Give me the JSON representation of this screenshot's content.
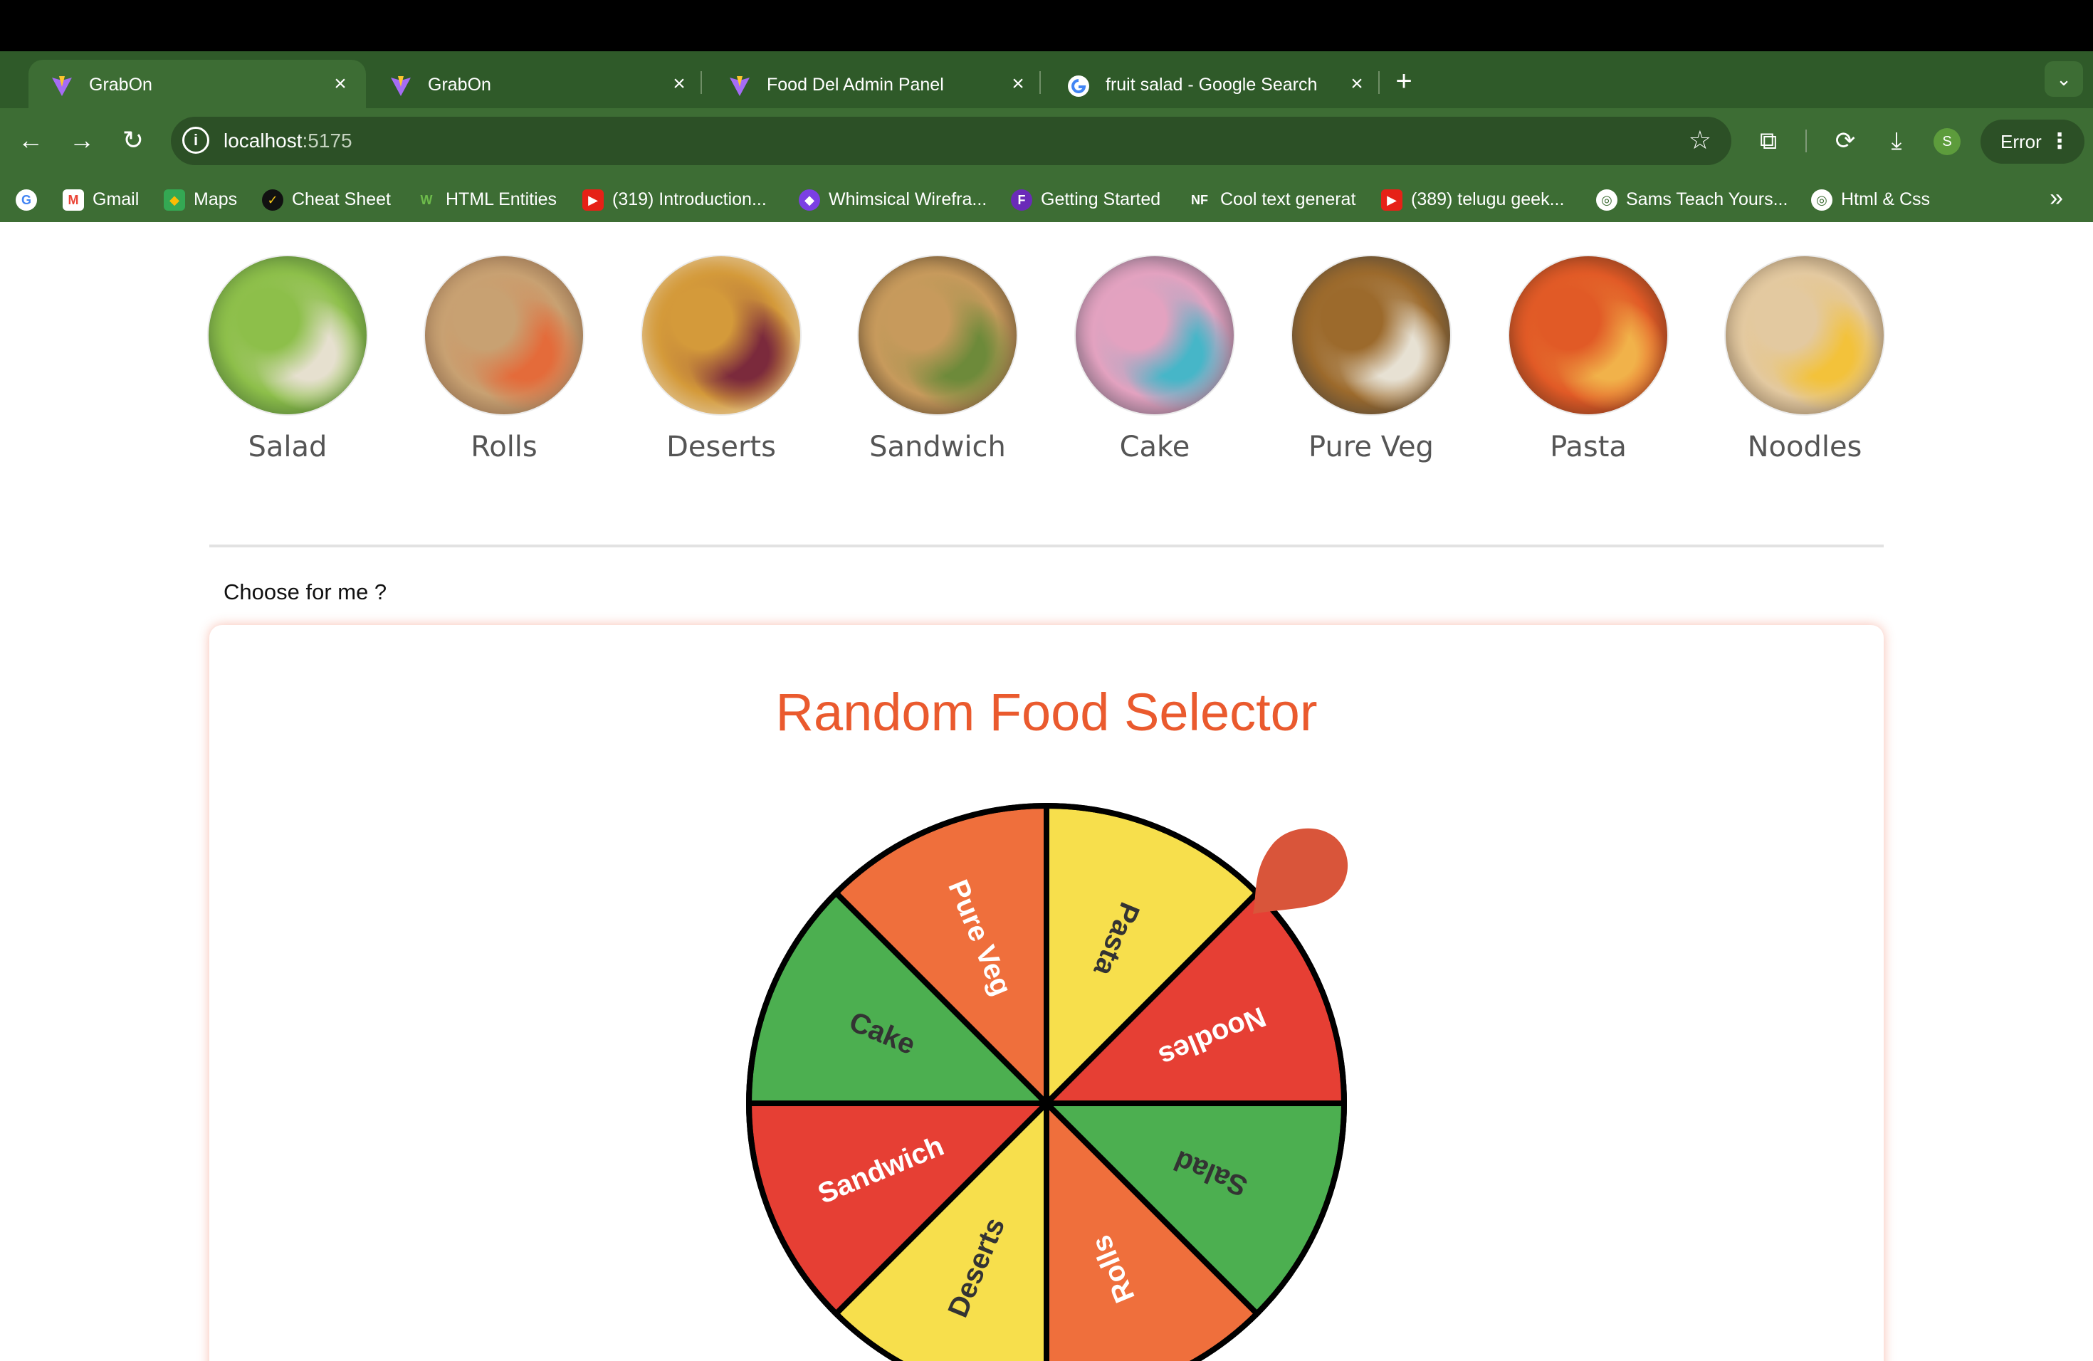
{
  "browser": {
    "tabs": [
      {
        "title": "GrabOn",
        "active": true
      },
      {
        "title": "GrabOn",
        "active": false
      },
      {
        "title": "Food Del Admin Panel",
        "active": false
      },
      {
        "title": "fruit salad - Google Search",
        "active": false
      }
    ],
    "url_host": "localhost",
    "url_port": ":5175",
    "profile_initial": "S",
    "error_label": "Error",
    "bookmarks": [
      {
        "label": "",
        "icon": "google-icon"
      },
      {
        "label": "Gmail",
        "icon": "gmail-icon"
      },
      {
        "label": "Maps",
        "icon": "maps-icon"
      },
      {
        "label": "Cheat Sheet",
        "icon": "cheat-sheet-icon"
      },
      {
        "label": "HTML Entities",
        "icon": "html-entities-icon"
      },
      {
        "label": "(319) Introduction...",
        "icon": "youtube-icon"
      },
      {
        "label": "Whimsical Wirefra...",
        "icon": "whimsical-icon"
      },
      {
        "label": "Getting Started",
        "icon": "getting-started-icon"
      },
      {
        "label": "Cool text generat",
        "icon": "nf-icon"
      },
      {
        "label": "(389) telugu geek...",
        "icon": "youtube-icon"
      },
      {
        "label": "Sams Teach Yours...",
        "icon": "globe-icon"
      },
      {
        "label": "Html & Css",
        "icon": "globe-icon"
      }
    ]
  },
  "categories": [
    {
      "label": "Salad",
      "colors": [
        "#2d4f2a",
        "#8dbf4a",
        "#e6e0cf"
      ]
    },
    {
      "label": "Rolls",
      "colors": [
        "#6b4a36",
        "#c8a172",
        "#e46b3a"
      ]
    },
    {
      "label": "Deserts",
      "colors": [
        "#e9e7e2",
        "#d49a3a",
        "#7b2a3c"
      ]
    },
    {
      "label": "Sandwich",
      "colors": [
        "#2a2018",
        "#c79a5c",
        "#6d8a3a"
      ]
    },
    {
      "label": "Cake",
      "colors": [
        "#2d3b45",
        "#e3a2c0",
        "#46b6c8"
      ]
    },
    {
      "label": "Pure Veg",
      "colors": [
        "#2a3440",
        "#9c6a2c",
        "#e7e1d3"
      ]
    },
    {
      "label": "Pasta",
      "colors": [
        "#3c2418",
        "#e15a26",
        "#f1b24a"
      ]
    },
    {
      "label": "Noodles",
      "colors": [
        "#5c4a38",
        "#e3c9a0",
        "#f3c23a"
      ]
    }
  ],
  "section": {
    "choose_label": "Choose for me ?",
    "title": "Random Food Selector",
    "title_color": "#ea5a2e"
  },
  "wheel": {
    "segments": [
      {
        "label": "Pasta",
        "color": "#f7df4c",
        "text_color": "#333333"
      },
      {
        "label": "Noodles",
        "color": "#e63f34",
        "text_color": "#ffffff"
      },
      {
        "label": "Salad",
        "color": "#4caf50",
        "text_color": "#333333"
      },
      {
        "label": "Rolls",
        "color": "#ef6f3c",
        "text_color": "#ffffff"
      },
      {
        "label": "Deserts",
        "color": "#f7df4c",
        "text_color": "#333333"
      },
      {
        "label": "Sandwich",
        "color": "#e63f34",
        "text_color": "#ffffff"
      },
      {
        "label": "Cake",
        "color": "#4caf50",
        "text_color": "#333333"
      },
      {
        "label": "Pure Veg",
        "color": "#ef6f3c",
        "text_color": "#ffffff"
      }
    ],
    "pointer_color": "#d9553a"
  }
}
